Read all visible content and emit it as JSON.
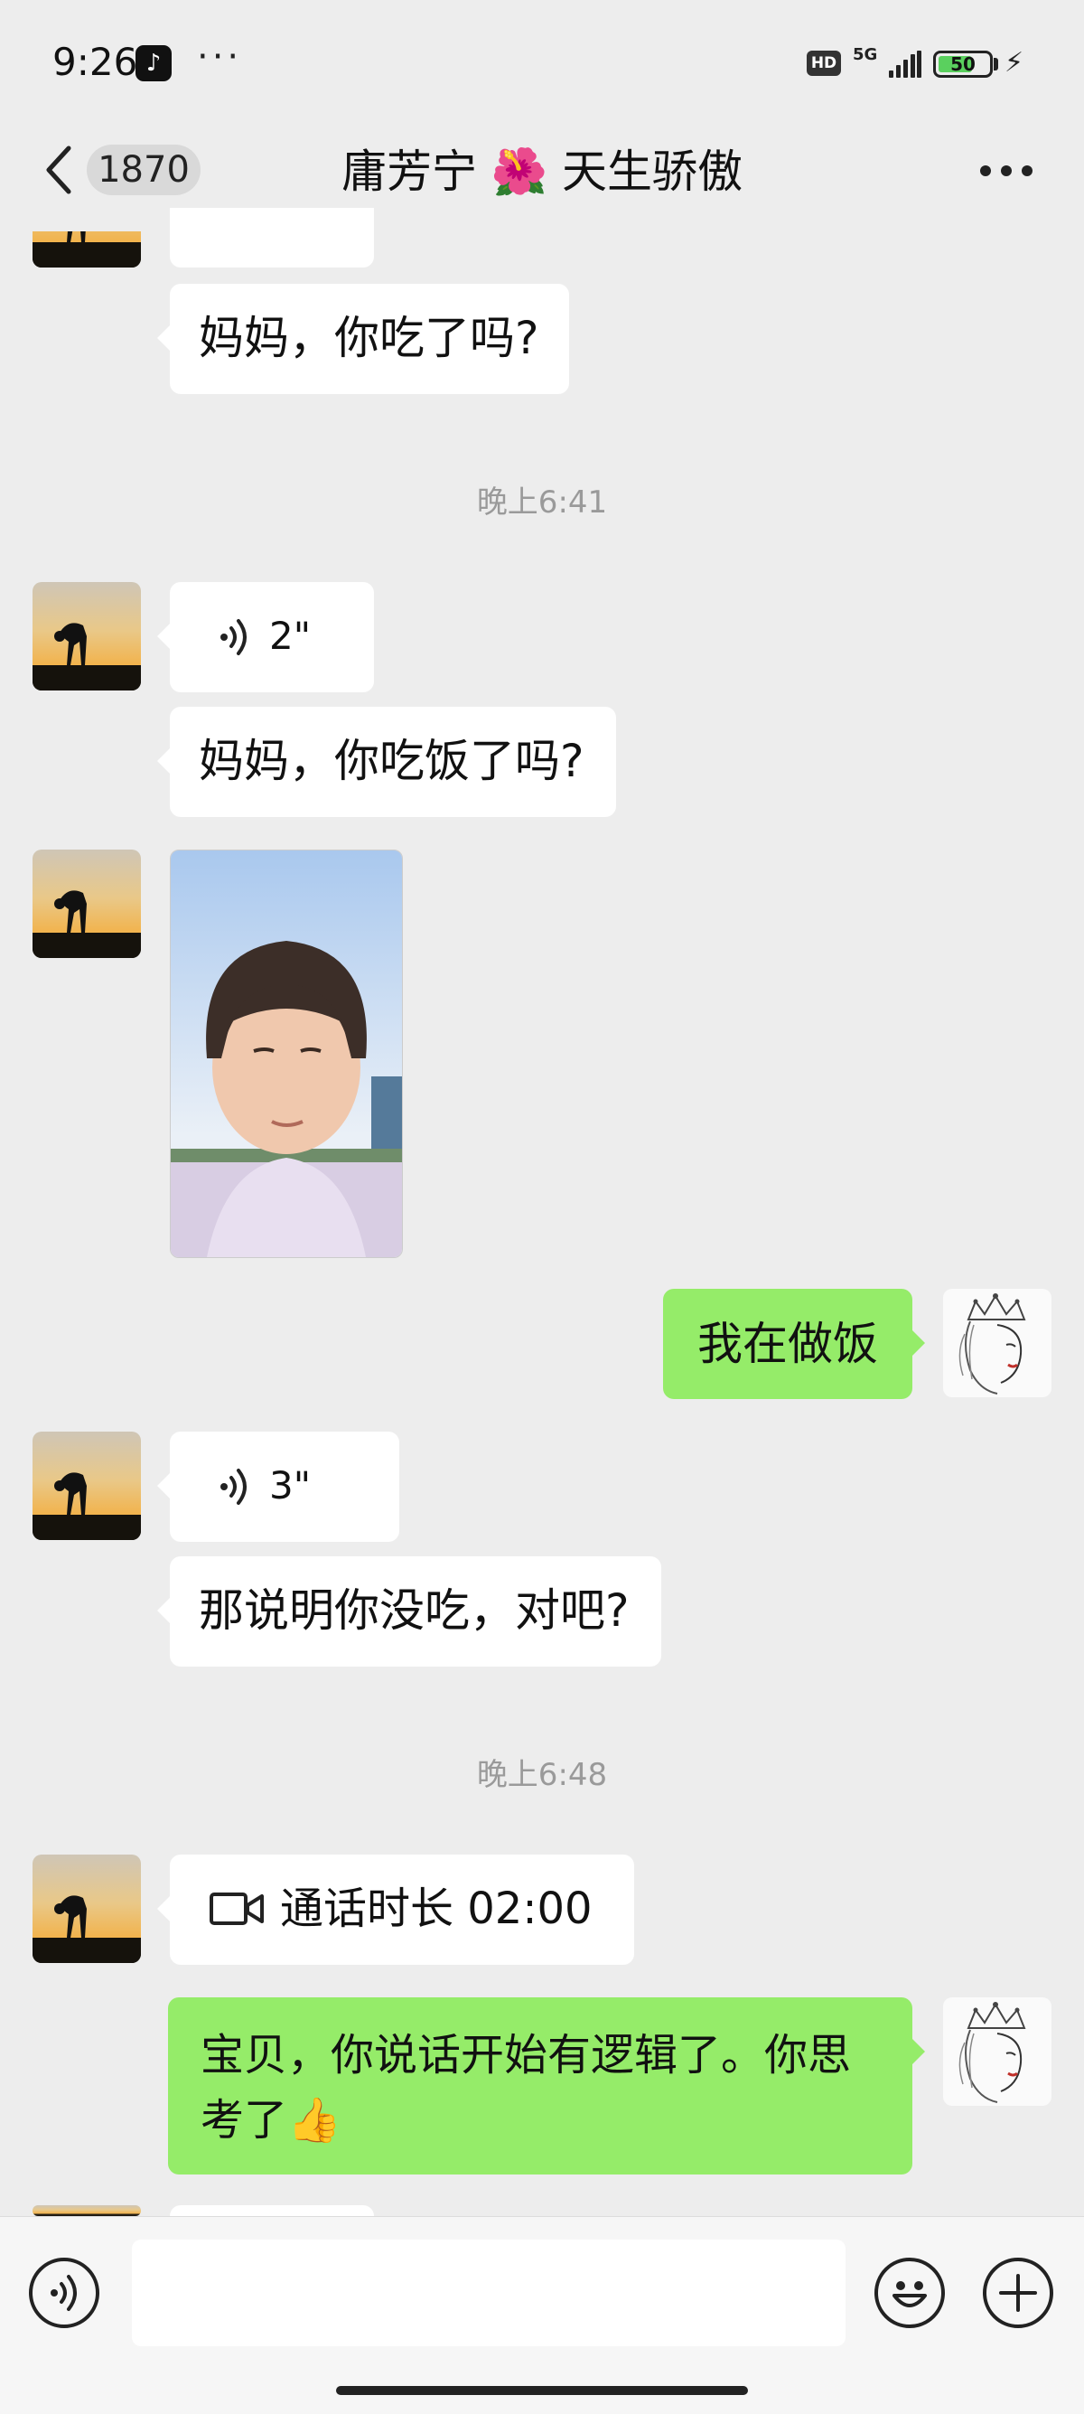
{
  "status_bar": {
    "time": "9:26",
    "tiktok_icon": "tiktok-app-icon",
    "overflow": "···",
    "hd": "HD",
    "network": "5G",
    "battery": "50"
  },
  "header": {
    "unread_count": "1870",
    "title": "庸芳宁 🌺 天生骄傲"
  },
  "messages": {
    "m1": "妈妈，你吃了吗?",
    "time1": "晚上6:41",
    "voice1": "2\"",
    "m2": "妈妈，你吃饭了吗?",
    "reply1": "我在做饭",
    "voice2": "3\"",
    "m3": "那说明你没吃，对吧?",
    "time2": "晚上6:48",
    "call": "通话时长 02:00",
    "reply2_line1": "宝贝，你说话开始有逻辑了。你思",
    "reply2_line2": "考了👍"
  },
  "input_bar": {
    "placeholder": ""
  },
  "colors": {
    "background": "#ededed",
    "outgoing_bubble": "#95ec69",
    "incoming_bubble": "#ffffff",
    "timestamp": "#9a9a9a"
  }
}
